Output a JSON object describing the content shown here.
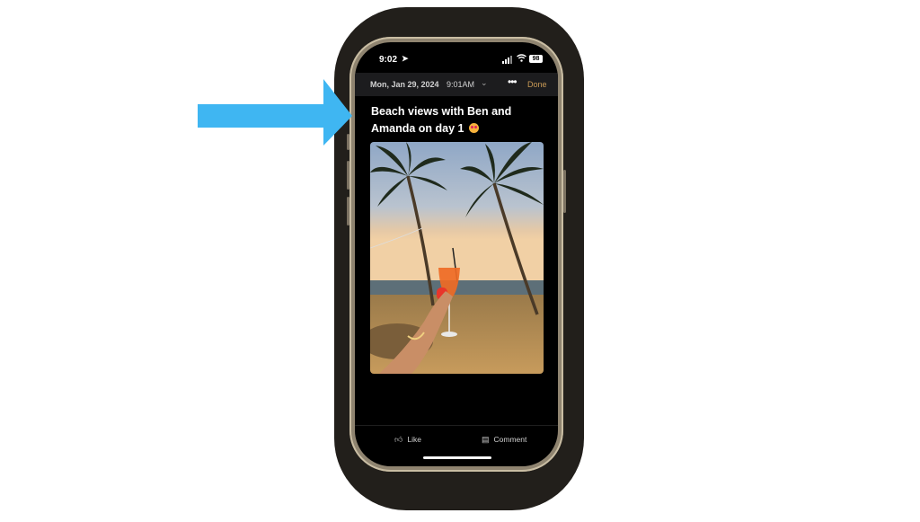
{
  "status_bar": {
    "time": "9:02",
    "battery": "98"
  },
  "entry_header": {
    "date": "Mon, Jan 29, 2024",
    "time": "9:01AM",
    "done_label": "Done"
  },
  "post": {
    "title_line1": "Beach views with Ben and",
    "title_line2": "Amanda on day 1"
  },
  "actions": {
    "like_label": "Like",
    "comment_label": "Comment"
  },
  "colors": {
    "accent_done": "#c99a56",
    "arrow": "#3fb6f2",
    "header_bg": "#1c1c1e"
  },
  "icons": [
    "location-arrow-icon",
    "cellular-signal-icon",
    "wifi-icon",
    "battery-icon",
    "chevron-down-icon",
    "more-icon",
    "thumbs-up-icon",
    "comment-icon",
    "face-emoji-icon"
  ]
}
